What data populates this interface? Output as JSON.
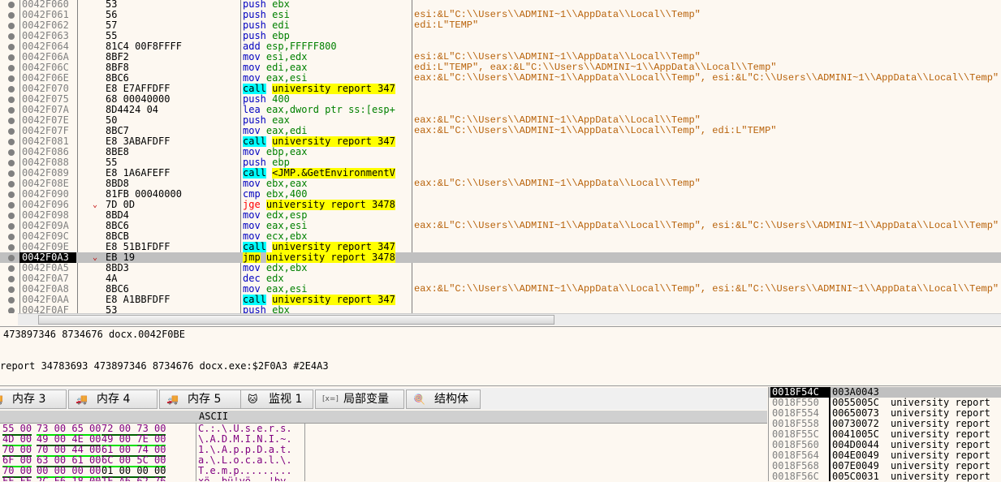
{
  "disasm": {
    "rows": [
      {
        "addr": "0042F060",
        "bytes": "53",
        "mn": "push",
        "ops": "ebx",
        "comment": ""
      },
      {
        "addr": "0042F061",
        "bytes": "56",
        "mn": "push",
        "ops": "esi",
        "comment": "esi:&L\"C:\\\\Users\\\\ADMINI~1\\\\AppData\\\\Local\\\\Temp\""
      },
      {
        "addr": "0042F062",
        "bytes": "57",
        "mn": "push",
        "ops": "edi",
        "comment": "edi:L\"TEMP\""
      },
      {
        "addr": "0042F063",
        "bytes": "55",
        "mn": "push",
        "ops": "ebp",
        "comment": ""
      },
      {
        "addr": "0042F064",
        "bytes": "81C4 00F8FFFF",
        "mn": "add",
        "ops": "esp,FFFFF800",
        "comment": ""
      },
      {
        "addr": "0042F06A",
        "bytes": "8BF2",
        "mn": "mov",
        "ops": "esi,edx",
        "comment": "esi:&L\"C:\\\\Users\\\\ADMINI~1\\\\AppData\\\\Local\\\\Temp\""
      },
      {
        "addr": "0042F06C",
        "bytes": "8BF8",
        "mn": "mov",
        "ops": "edi,eax",
        "comment": "edi:L\"TEMP\", eax:&L\"C:\\\\Users\\\\ADMINI~1\\\\AppData\\\\Local\\\\Temp\""
      },
      {
        "addr": "0042F06E",
        "bytes": "8BC6",
        "mn": "mov",
        "ops": "eax,esi",
        "comment": "eax:&L\"C:\\\\Users\\\\ADMINI~1\\\\AppData\\\\Local\\\\Temp\", esi:&L\"C:\\\\Users\\\\ADMINI~1\\\\AppData\\\\Local\\\\Temp\""
      },
      {
        "addr": "0042F070",
        "bytes": "E8 E7AFFDFF",
        "mn": "call",
        "ops": "university report 347",
        "comment": ""
      },
      {
        "addr": "0042F075",
        "bytes": "68 00040000",
        "mn": "push",
        "ops": "400",
        "comment": ""
      },
      {
        "addr": "0042F07A",
        "bytes": "8D4424 04",
        "mn": "lea",
        "ops": "eax,dword ptr ss:[esp+",
        "comment": ""
      },
      {
        "addr": "0042F07E",
        "bytes": "50",
        "mn": "push",
        "ops": "eax",
        "comment": "eax:&L\"C:\\\\Users\\\\ADMINI~1\\\\AppData\\\\Local\\\\Temp\""
      },
      {
        "addr": "0042F07F",
        "bytes": "8BC7",
        "mn": "mov",
        "ops": "eax,edi",
        "comment": "eax:&L\"C:\\\\Users\\\\ADMINI~1\\\\AppData\\\\Local\\\\Temp\", edi:L\"TEMP\""
      },
      {
        "addr": "0042F081",
        "bytes": "E8 3ABAFDFF",
        "mn": "call",
        "ops": "university report 347",
        "comment": ""
      },
      {
        "addr": "0042F086",
        "bytes": "8BE8",
        "mn": "mov",
        "ops": "ebp,eax",
        "comment": ""
      },
      {
        "addr": "0042F088",
        "bytes": "55",
        "mn": "push",
        "ops": "ebp",
        "comment": ""
      },
      {
        "addr": "0042F089",
        "bytes": "E8 1A6AFEFF",
        "mn": "call",
        "ops": "<JMP.&GetEnvironmentV",
        "comment": ""
      },
      {
        "addr": "0042F08E",
        "bytes": "8BD8",
        "mn": "mov",
        "ops": "ebx,eax",
        "comment": "eax:&L\"C:\\\\Users\\\\ADMINI~1\\\\AppData\\\\Local\\\\Temp\""
      },
      {
        "addr": "0042F090",
        "bytes": "81FB 00040000",
        "mn": "cmp",
        "ops": "ebx,400",
        "comment": ""
      },
      {
        "addr": "0042F096",
        "bytes": "7D 0D",
        "mn": "jge",
        "ops": "university report 3478",
        "comment": "",
        "arrow": "v"
      },
      {
        "addr": "0042F098",
        "bytes": "8BD4",
        "mn": "mov",
        "ops": "edx,esp",
        "comment": ""
      },
      {
        "addr": "0042F09A",
        "bytes": "8BC6",
        "mn": "mov",
        "ops": "eax,esi",
        "comment": "eax:&L\"C:\\\\Users\\\\ADMINI~1\\\\AppData\\\\Local\\\\Temp\", esi:&L\"C:\\\\Users\\\\ADMINI~1\\\\AppData\\\\Local\\\\Temp\""
      },
      {
        "addr": "0042F09C",
        "bytes": "8BCB",
        "mn": "mov",
        "ops": "ecx,ebx",
        "comment": ""
      },
      {
        "addr": "0042F09E",
        "bytes": "E8 51B1FDFF",
        "mn": "call",
        "ops": "university report 347",
        "comment": ""
      },
      {
        "addr": "0042F0A3",
        "bytes": "EB 19",
        "mn": "jmp",
        "ops": "university report 3478",
        "comment": "",
        "arrow": "v",
        "selected": true
      },
      {
        "addr": "0042F0A5",
        "bytes": "8BD3",
        "mn": "mov",
        "ops": "edx,ebx",
        "comment": ""
      },
      {
        "addr": "0042F0A7",
        "bytes": "4A",
        "mn": "dec",
        "ops": "edx",
        "comment": ""
      },
      {
        "addr": "0042F0A8",
        "bytes": "8BC6",
        "mn": "mov",
        "ops": "eax,esi",
        "comment": "eax:&L\"C:\\\\Users\\\\ADMINI~1\\\\AppData\\\\Local\\\\Temp\", esi:&L\"C:\\\\Users\\\\ADMINI~1\\\\AppData\\\\Local\\\\Temp\""
      },
      {
        "addr": "0042F0AA",
        "bytes": "E8 A1BBFDFF",
        "mn": "call",
        "ops": "university report 347",
        "comment": ""
      },
      {
        "addr": "0042F0AF",
        "bytes": "53",
        "mn": "push",
        "ops": "ebx",
        "comment": ""
      }
    ]
  },
  "info": {
    "line1": "473897346 8734676 docx.0042F0BE",
    "line2": "report 34783693 473897346 8734676 docx.exe:$2F0A3 #2E4A3"
  },
  "tabs": [
    {
      "label": "内存 3",
      "icon": "memory-icon"
    },
    {
      "label": "内存 4",
      "icon": "memory-icon"
    },
    {
      "label": "内存 5",
      "icon": "memory-icon"
    },
    {
      "label": "监视 1",
      "icon": "watch-icon"
    },
    {
      "label": "局部变量",
      "icon": "local-vars-icon"
    },
    {
      "label": "结构体",
      "icon": "struct-icon"
    }
  ],
  "hex": {
    "ascii_header": "ASCII",
    "rows": [
      {
        "groups": [
          "55 00",
          "73 00 65 00",
          "72 00 73 00"
        ],
        "ascii": "C.:.\\.U.s.e.r.s."
      },
      {
        "groups": [
          "4D 00",
          "49 00 4E 00",
          "49 00 7E 00"
        ],
        "ascii": "\\.A.D.M.I.N.I.~."
      },
      {
        "groups": [
          "70 00",
          "70 00 44 00",
          "61 00 74 00"
        ],
        "ascii": "1.\\.A.p.p.D.a.t."
      },
      {
        "groups": [
          "6F 00",
          "63 00 61 00",
          "6C 00 5C 00"
        ],
        "ascii": "a.\\.L.o.c.a.l.\\."
      },
      {
        "groups": [
          "70 00",
          "00 00 00 00",
          "01 00 00 00"
        ],
        "ascii": "T.e.m.p........."
      },
      {
        "groups": [
          "FF FF",
          "2C F6 18 00",
          "1F A6 62 76"
        ],
        "ascii": "xö..bü¦vö...¦bv"
      }
    ]
  },
  "stack": {
    "rows": [
      {
        "addr": "0018F54C",
        "value": "003A0043",
        "comment": ""
      },
      {
        "addr": "0018F550",
        "value": "0055005C",
        "comment": "university report"
      },
      {
        "addr": "0018F554",
        "value": "00650073",
        "comment": "university report"
      },
      {
        "addr": "0018F558",
        "value": "00730072",
        "comment": "university report"
      },
      {
        "addr": "0018F55C",
        "value": "0041005C",
        "comment": "university report"
      },
      {
        "addr": "0018F560",
        "value": "004D0044",
        "comment": "university report"
      },
      {
        "addr": "0018F564",
        "value": "004E0049",
        "comment": "university report"
      },
      {
        "addr": "0018F568",
        "value": "007E0049",
        "comment": "university report"
      },
      {
        "addr": "0018F56C",
        "value": "005C0031",
        "comment": "university report"
      }
    ]
  },
  "colors": {
    "background": "#fdf8f1",
    "call_bg": "#00ffff",
    "target_bg": "#ffff00",
    "comment": "#b8620a"
  }
}
